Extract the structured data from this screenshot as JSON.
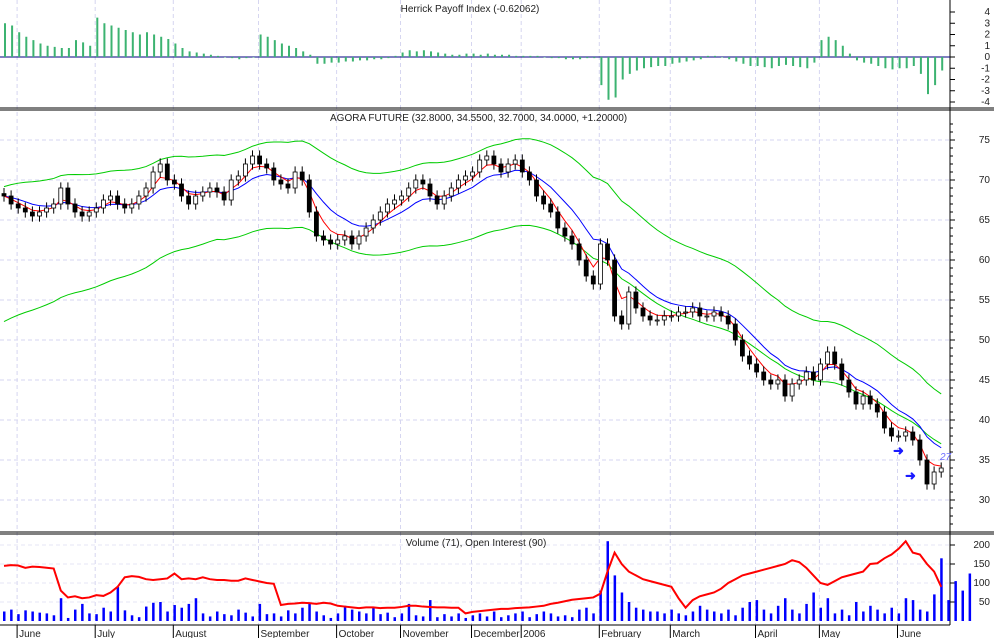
{
  "chart_data": [
    {
      "type": "bar",
      "title": "Herrick Payoff Index (-0.62062)",
      "yticks": [
        4,
        3,
        2,
        1,
        0,
        -1,
        -2,
        -3,
        -4
      ],
      "ylim": [
        -4,
        4
      ],
      "color": "#3cb371",
      "values": [
        3,
        2.8,
        2.2,
        1.8,
        1.5,
        1.2,
        1,
        0.9,
        0.8,
        0.8,
        1.5,
        1.3,
        1.0,
        3.5,
        3,
        2.8,
        2.6,
        2.4,
        2.2,
        2,
        2.2,
        2,
        1.8,
        1.6,
        1.2,
        0.8,
        0.5,
        0.4,
        0.3,
        0.2,
        0.1,
        0,
        -0.1,
        -0.2,
        -0.1,
        0,
        2,
        1.8,
        1.5,
        1.2,
        1,
        0.8,
        0.5,
        0.2,
        -0.6,
        -0.6,
        -0.5,
        -0.5,
        -0.4,
        -0.4,
        -0.3,
        -0.3,
        -0.2,
        -0.2,
        -0.1,
        0.1,
        0.4,
        0.6,
        0.5,
        0.6,
        0.5,
        0.4,
        0.3,
        0.2,
        0.2,
        0.3,
        0.3,
        0.2,
        0.3,
        0.2,
        0.2,
        0.2,
        0.1,
        0.1,
        0.1,
        0.1,
        0,
        -0.1,
        -0.1,
        -0.2,
        -0.2,
        -0.2,
        -0.1,
        -0.1,
        -2.5,
        -3.8,
        -3.6,
        -2,
        -1.5,
        -1.2,
        -1.0,
        -0.9,
        -0.8,
        -0.8,
        -0.6,
        -0.5,
        -0.4,
        -0.3,
        -0.2,
        0.1,
        0.1,
        0,
        -0.2,
        -0.4,
        -0.6,
        -0.8,
        -0.8,
        -0.9,
        -1,
        -0.8,
        -0.7,
        -0.8,
        -0.9,
        -1,
        -0.5,
        1.5,
        1.8,
        1.5,
        1,
        0.3,
        -0.3,
        -0.5,
        -0.6,
        -0.8,
        -1,
        -1.1,
        -1,
        -1,
        -0.8,
        -1.5,
        -3.3,
        -2.5,
        -1.2
      ]
    },
    {
      "type": "candlestick",
      "title": "AGORA FUTURE (32.8000, 34.5500, 32.7000, 34.0000, +1.20000)",
      "yticks": [
        75,
        70,
        65,
        60,
        55,
        50,
        45,
        40,
        35,
        30
      ],
      "ylim": [
        26,
        77
      ],
      "colors": {
        "up": "#ffffff",
        "down": "#000000",
        "fast_ma": "#ff0000",
        "slow_ma": "#0000ff",
        "bands": "#00cc00"
      },
      "close": [
        68,
        67,
        66.5,
        66,
        65.5,
        66,
        66.5,
        67,
        69,
        67,
        66,
        65.5,
        66,
        66.5,
        67.5,
        68,
        67,
        66.5,
        67,
        68,
        69,
        71,
        72,
        70,
        69.5,
        68,
        67,
        68,
        68.5,
        69,
        68.5,
        67.5,
        70,
        70.5,
        72,
        73,
        72,
        71.5,
        70,
        69.5,
        69,
        71,
        70,
        66,
        63,
        62.5,
        62,
        62.5,
        63,
        62,
        63,
        64,
        65,
        66,
        67,
        67.5,
        68,
        69,
        70,
        69.5,
        68,
        67,
        68,
        69,
        70,
        70.5,
        71,
        72.5,
        73,
        72,
        71,
        72,
        72.5,
        71,
        70,
        68,
        67,
        66,
        64,
        63,
        62,
        60,
        58,
        57,
        62,
        60,
        53,
        52,
        56,
        54,
        53,
        52.5,
        52.5,
        53,
        53,
        53.5,
        53.5,
        54,
        53,
        53,
        53.5,
        53,
        52,
        50,
        48,
        47,
        46,
        45,
        44.5,
        45,
        43,
        44.5,
        45,
        46,
        45,
        47,
        48.5,
        47,
        45,
        43.5,
        42,
        43,
        42,
        41,
        39,
        38,
        38,
        38.5,
        37.5,
        35,
        32,
        33.5,
        34
      ],
      "annotation": "27"
    },
    {
      "type": "bar+line",
      "title": "Volume (71), Open Interest (90)",
      "yticks": [
        200,
        150,
        100,
        50
      ],
      "ylim": [
        0,
        210
      ],
      "volume_color": "#0000ff",
      "oi_color": "#ff0000",
      "volume": [
        25,
        30,
        18,
        28,
        25,
        22,
        20,
        15,
        60,
        8,
        30,
        45,
        20,
        18,
        35,
        25,
        90,
        28,
        15,
        10,
        38,
        48,
        50,
        25,
        42,
        35,
        45,
        60,
        20,
        12,
        25,
        18,
        15,
        30,
        22,
        12,
        45,
        18,
        20,
        12,
        28,
        20,
        35,
        48,
        25,
        15,
        8,
        20,
        40,
        30,
        25,
        20,
        35,
        18,
        22,
        10,
        20,
        45,
        15,
        12,
        55,
        10,
        18,
        12,
        20,
        8,
        15,
        20,
        12,
        25,
        10,
        15,
        20,
        25,
        10,
        18,
        25,
        20,
        12,
        15,
        10,
        30,
        35,
        20,
        80,
        210,
        120,
        75,
        50,
        35,
        30,
        25,
        25,
        20,
        30,
        20,
        15,
        25,
        40,
        30,
        25,
        20,
        30,
        15,
        35,
        50,
        55,
        30,
        20,
        40,
        60,
        30,
        20,
        45,
        75,
        35,
        60,
        20,
        30,
        15,
        50,
        25,
        40,
        30,
        20,
        35,
        20,
        60,
        55,
        30,
        25,
        70,
        165,
        55,
        105,
        80,
        125
      ],
      "open_interest": [
        145,
        147,
        146,
        140,
        143,
        142,
        140,
        138,
        80,
        62,
        65,
        60,
        62,
        68,
        66,
        75,
        90,
        115,
        118,
        116,
        110,
        108,
        110,
        112,
        125,
        110,
        112,
        110,
        115,
        110,
        108,
        108,
        106,
        106,
        112,
        108,
        104,
        100,
        98,
        42,
        45,
        46,
        48,
        47,
        45,
        48,
        46,
        40,
        38,
        36,
        34,
        36,
        36,
        34,
        35,
        35,
        37,
        40,
        40,
        38,
        37,
        36,
        36,
        35,
        35,
        20,
        24,
        26,
        28,
        30,
        32,
        32,
        34,
        35,
        36,
        38,
        40,
        45,
        48,
        52,
        56,
        58,
        60,
        62,
        72,
        130,
        180,
        150,
        130,
        120,
        110,
        105,
        100,
        95,
        90,
        60,
        35,
        55,
        65,
        70,
        75,
        85,
        100,
        110,
        120,
        125,
        130,
        135,
        140,
        145,
        150,
        160,
        155,
        140,
        120,
        100,
        95,
        105,
        115,
        120,
        125,
        130,
        150,
        152,
        165,
        175,
        190,
        210,
        180,
        175,
        150,
        130,
        90
      ]
    }
  ],
  "x_axis": {
    "labels": [
      {
        "label": "June",
        "bar": 1
      },
      {
        "label": "July",
        "bar": 12
      },
      {
        "label": "August",
        "bar": 23
      },
      {
        "label": "September",
        "bar": 35
      },
      {
        "label": "October",
        "bar": 46
      },
      {
        "label": "November",
        "bar": 55
      },
      {
        "label": "December",
        "bar": 65
      },
      {
        "label": "2006",
        "bar": 72
      },
      {
        "label": "February",
        "bar": 83
      },
      {
        "label": "March",
        "bar": 93
      },
      {
        "label": "April",
        "bar": 105
      },
      {
        "label": "May",
        "bar": 114
      },
      {
        "label": "June",
        "bar": 125
      }
    ]
  }
}
